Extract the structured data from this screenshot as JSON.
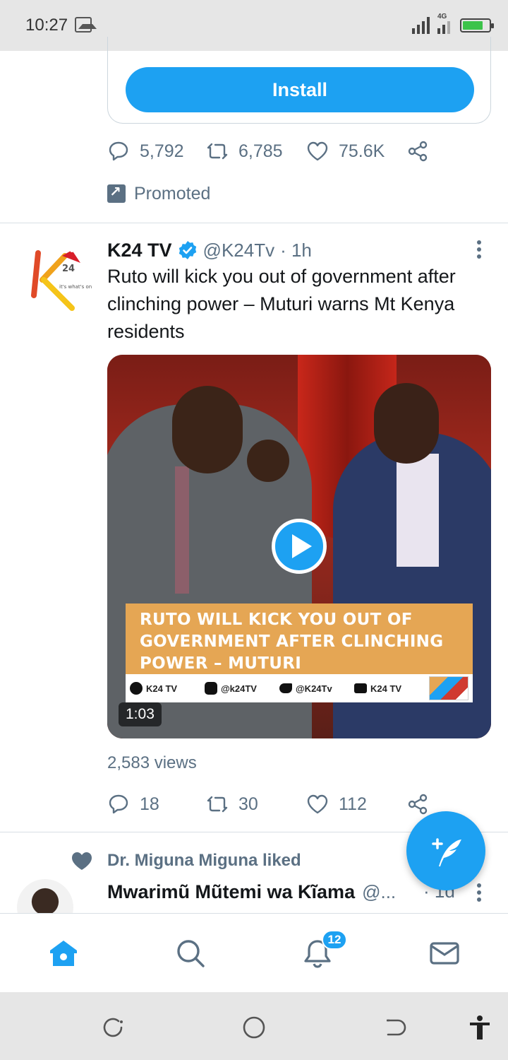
{
  "status_bar": {
    "time": "10:27",
    "network": "4G"
  },
  "promoted_card": {
    "install_label": "Install"
  },
  "promoted_actions": {
    "replies": "5,792",
    "retweets": "6,785",
    "likes": "75.6K"
  },
  "promoted_label": "Promoted",
  "tweet": {
    "name": "K24 TV",
    "handle": "@K24Tv",
    "time": "· 1h",
    "text": "Ruto will kick you out of government after clinching power – Muturi warns Mt Kenya residents",
    "media": {
      "banner_text": "RUTO WILL KICK YOU OUT OF GOVERNMENT AFTER CLINCHING POWER – MUTURI",
      "social": [
        "K24 TV",
        "@k24TV",
        "@K24Tv",
        "K24 TV"
      ],
      "duration": "1:03"
    },
    "views": "2,583 views",
    "actions": {
      "replies": "18",
      "retweets": "30",
      "likes": "112"
    }
  },
  "next_tweet": {
    "liked_by": "Dr. Miguna Miguna liked",
    "name": "Mwarimũ Mũtemi wa Kĩama",
    "handle": "@...",
    "time": "· 1d"
  },
  "bottom_nav": {
    "notifications_badge": "12"
  },
  "colors": {
    "accent": "#1da1f2",
    "secondary_text": "#5b7083",
    "banner": "#e5a654"
  },
  "icons": [
    "image-icon",
    "signal-icon",
    "battery-icon",
    "reply-icon",
    "retweet-icon",
    "like-icon",
    "share-icon",
    "promoted-icon",
    "verified-icon",
    "more-icon",
    "play-icon",
    "heart-icon",
    "compose-icon",
    "home-icon",
    "search-icon",
    "notifications-icon",
    "messages-icon"
  ]
}
